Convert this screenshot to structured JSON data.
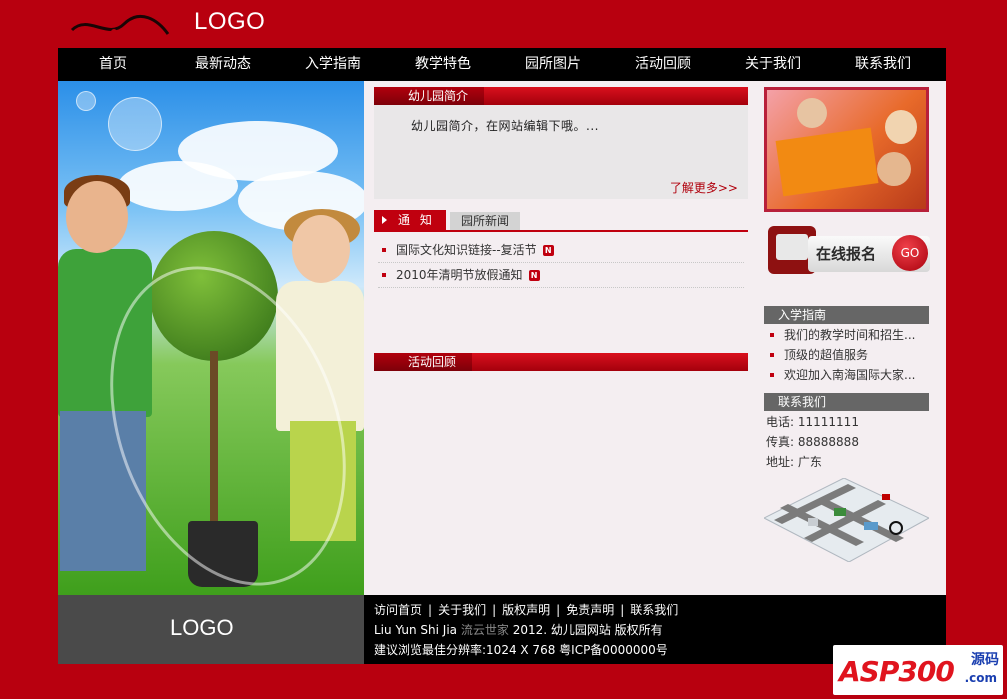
{
  "header": {
    "brand_calligraphy": "流云世家",
    "logo_text": "LOGO"
  },
  "nav": [
    "首页",
    "最新动态",
    "入学指南",
    "教学特色",
    "园所图片",
    "活动回顾",
    "关于我们",
    "联系我们"
  ],
  "hero": {
    "logo_text": "LOGO"
  },
  "intro": {
    "title": "幼儿园简介",
    "text": "幼儿园简介，在网站编辑下哦。...",
    "more": "了解更多>>"
  },
  "notices": {
    "tab_active": "通 知",
    "tab_other": "园所新闻",
    "items": [
      {
        "text": "国际文化知识链接--复活节",
        "badge": "N"
      },
      {
        "text": "2010年清明节放假通知",
        "badge": "N"
      }
    ]
  },
  "activities": {
    "title": "活动回顾"
  },
  "signup": {
    "label": "在线报名",
    "go": "GO"
  },
  "guide": {
    "title": "入学指南",
    "items": [
      "我们的教学时间和招生...",
      "顶级的超值服务",
      "欢迎加入南海国际大家..."
    ]
  },
  "contact": {
    "title": "联系我们",
    "phone_label": "电话:",
    "phone": "11111111",
    "fax_label": "传真:",
    "fax": "88888888",
    "addr_label": "地址:",
    "addr": "广东"
  },
  "footer": {
    "links": [
      "访问首页",
      "关于我们",
      "版权声明",
      "免责声明",
      "联系我们"
    ],
    "sep": "|",
    "copy_prefix": "Liu Yun Shi Jia",
    "copy_brand": "流云世家",
    "copy_suffix": "2012. 幼儿园网站 版权所有",
    "icp": "建议浏览最佳分辨率:1024 X 768 粤ICP备0000000号"
  },
  "watermark": {
    "asp": "ASP300",
    "cn": "源码",
    "com": ".com"
  },
  "colors": {
    "page_bg": "#b8000f",
    "accent": "#c0000f",
    "nav_bg": "#000000"
  }
}
